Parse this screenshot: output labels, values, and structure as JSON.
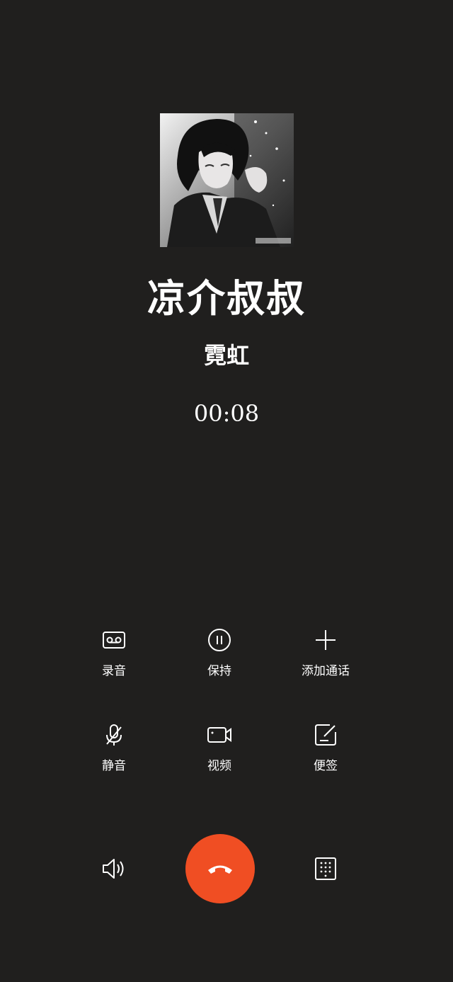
{
  "call": {
    "caller_name": "凉介叔叔",
    "caller_location": "霓虹",
    "timer": "00:08"
  },
  "actions": {
    "record": {
      "label": "录音",
      "icon": "cassette-icon"
    },
    "hold": {
      "label": "保持",
      "icon": "pause-circle-icon"
    },
    "add_call": {
      "label": "添加通话",
      "icon": "plus-icon"
    },
    "mute": {
      "label": "静音",
      "icon": "mic-off-icon"
    },
    "video": {
      "label": "视频",
      "icon": "video-camera-icon"
    },
    "notes": {
      "label": "便签",
      "icon": "note-edit-icon"
    }
  },
  "bottom_bar": {
    "speaker_icon": "speaker-icon",
    "hangup_icon": "end-call-icon",
    "keypad_icon": "keypad-icon"
  },
  "colors": {
    "background": "#201f1e",
    "hangup": "#f04e23",
    "text": "#ffffff"
  }
}
